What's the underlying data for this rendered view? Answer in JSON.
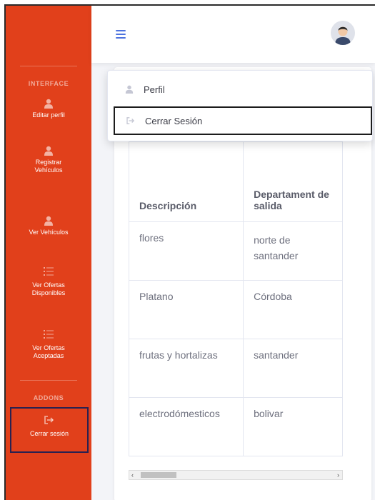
{
  "sidebar": {
    "heading_interface": "INTERFACE",
    "heading_addons": "ADDONS",
    "items": [
      {
        "label": "Editar perfil",
        "icon": "user-icon"
      },
      {
        "label": "Registrar Vehículos",
        "icon": "user-icon"
      },
      {
        "label": "Ver Vehículos",
        "icon": "user-icon"
      },
      {
        "label": "Ver Ofertas Disponibles",
        "icon": "list-icon"
      },
      {
        "label": "Ver Ofertas Aceptadas",
        "icon": "list-icon"
      }
    ],
    "logout": {
      "label": "Cerrar sesión",
      "icon": "sign-out-icon"
    }
  },
  "topbar": {
    "menu_icon": "hamburger-icon",
    "avatar_icon": "avatar-icon"
  },
  "dropdown": {
    "items": [
      {
        "label": "Perfil",
        "icon": "user-icon"
      },
      {
        "label": "Cerrar Sesión",
        "icon": "sign-out-icon"
      }
    ]
  },
  "table": {
    "headers": [
      "Descripción",
      "Departament de salida"
    ],
    "rows": [
      [
        "flores",
        "norte de santander"
      ],
      [
        "Platano",
        "Córdoba"
      ],
      [
        "frutas y hortalizas",
        "santander"
      ],
      [
        "electrodómesticos",
        "bolivar"
      ]
    ]
  },
  "colors": {
    "sidebar": "#e1401b",
    "accent": "#4e73df",
    "page_bg": "#f3f4f8"
  }
}
